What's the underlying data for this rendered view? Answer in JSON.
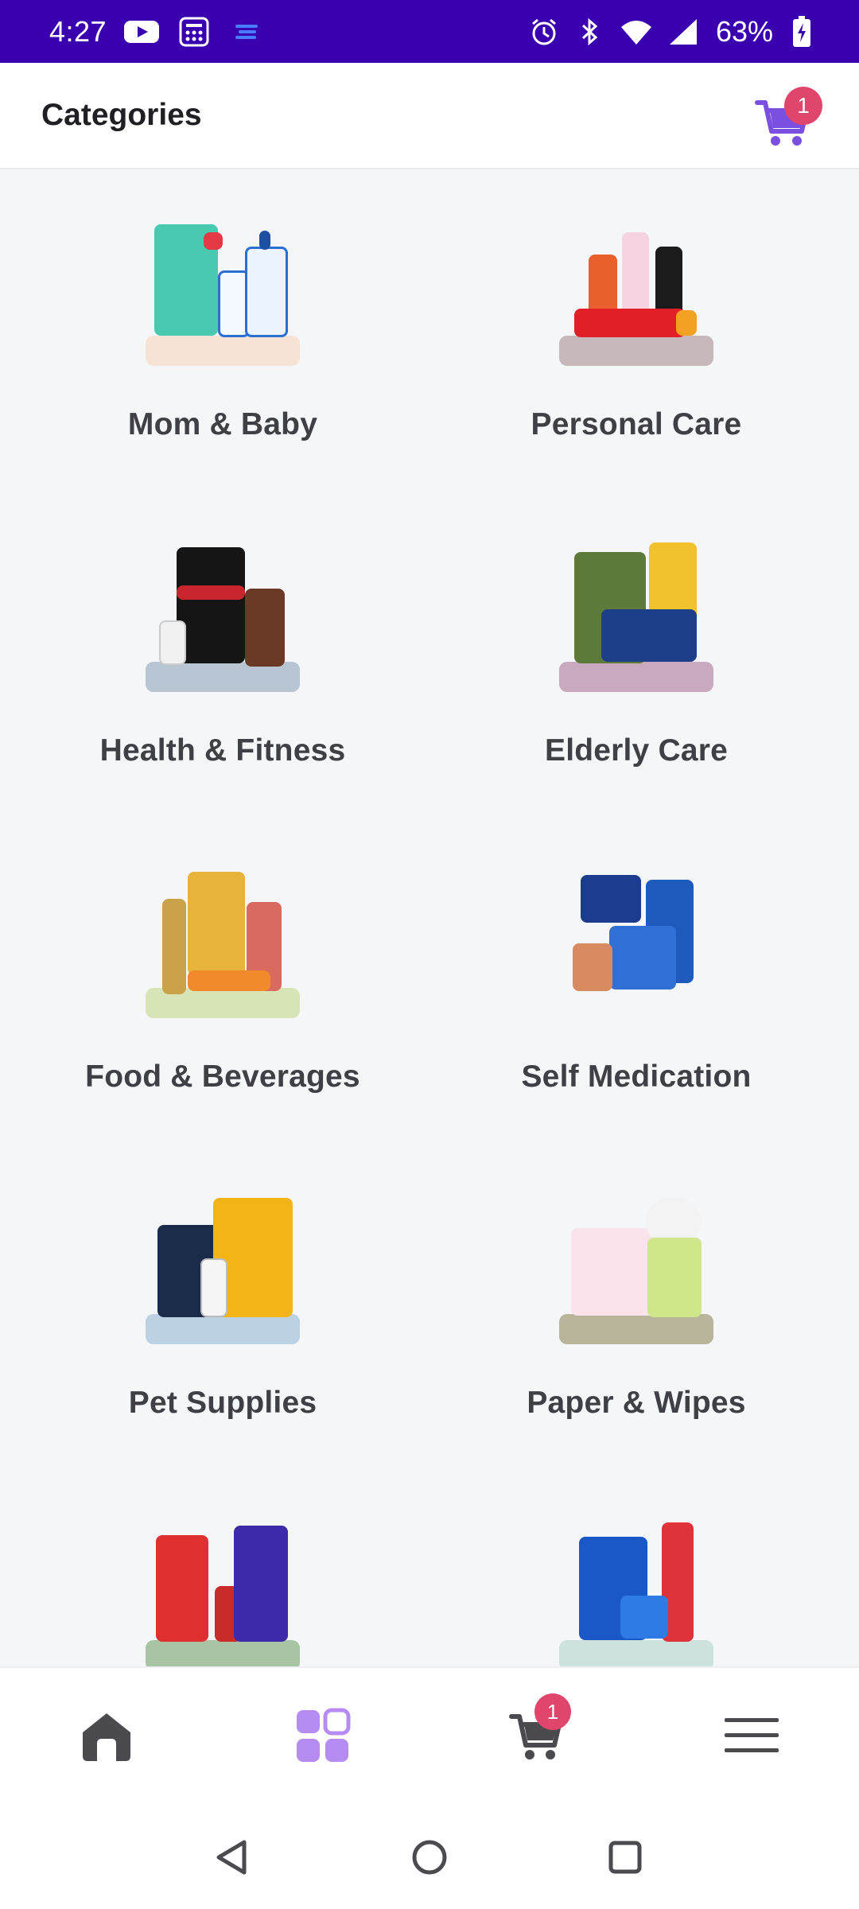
{
  "status_bar": {
    "time": "4:27",
    "battery": "63%",
    "icons": [
      "youtube-icon",
      "calculator-icon",
      "notification-lines-icon",
      "alarm-icon",
      "bluetooth-icon",
      "wifi-icon",
      "signal-icon",
      "battery-charging-icon"
    ]
  },
  "header": {
    "title": "Categories",
    "cart_count": "1"
  },
  "categories": [
    {
      "label": "Mom & Baby",
      "icon": "mom-baby-products-image",
      "plate_color": "#f7e3d6"
    },
    {
      "label": "Personal Care",
      "icon": "personal-care-products-image",
      "plate_color": "#c7b8ba"
    },
    {
      "label": "Health & Fitness",
      "icon": "health-fitness-products-image",
      "plate_color": "#b8c6d3"
    },
    {
      "label": "Elderly Care",
      "icon": "elderly-care-products-image",
      "plate_color": "#c8a9bd"
    },
    {
      "label": "Food & Beverages",
      "icon": "food-beverages-products-image",
      "plate_color": "#d7e5b6"
    },
    {
      "label": "Self Medication",
      "icon": "self-medication-products-image",
      "plate_color": "#f5f6f8"
    },
    {
      "label": "Pet Supplies",
      "icon": "pet-supplies-products-image",
      "plate_color": "#bcd1e3"
    },
    {
      "label": "Paper & Wipes",
      "icon": "paper-wipes-products-image",
      "plate_color": "#b8b59b"
    },
    {
      "label": "",
      "icon": "household-care-products-image",
      "plate_color": "#a9c4a5"
    },
    {
      "label": "",
      "icon": "sexual-wellness-products-image",
      "plate_color": "#cde2dd"
    }
  ],
  "bottom_nav": {
    "items": [
      "home-icon",
      "categories-grid-icon",
      "cart-icon",
      "menu-icon"
    ],
    "active": "categories-grid-icon",
    "cart_count": "1"
  },
  "colors": {
    "status_bar": "#3a00b0",
    "accent": "#7b4fe0",
    "badge": "#e0456c"
  }
}
